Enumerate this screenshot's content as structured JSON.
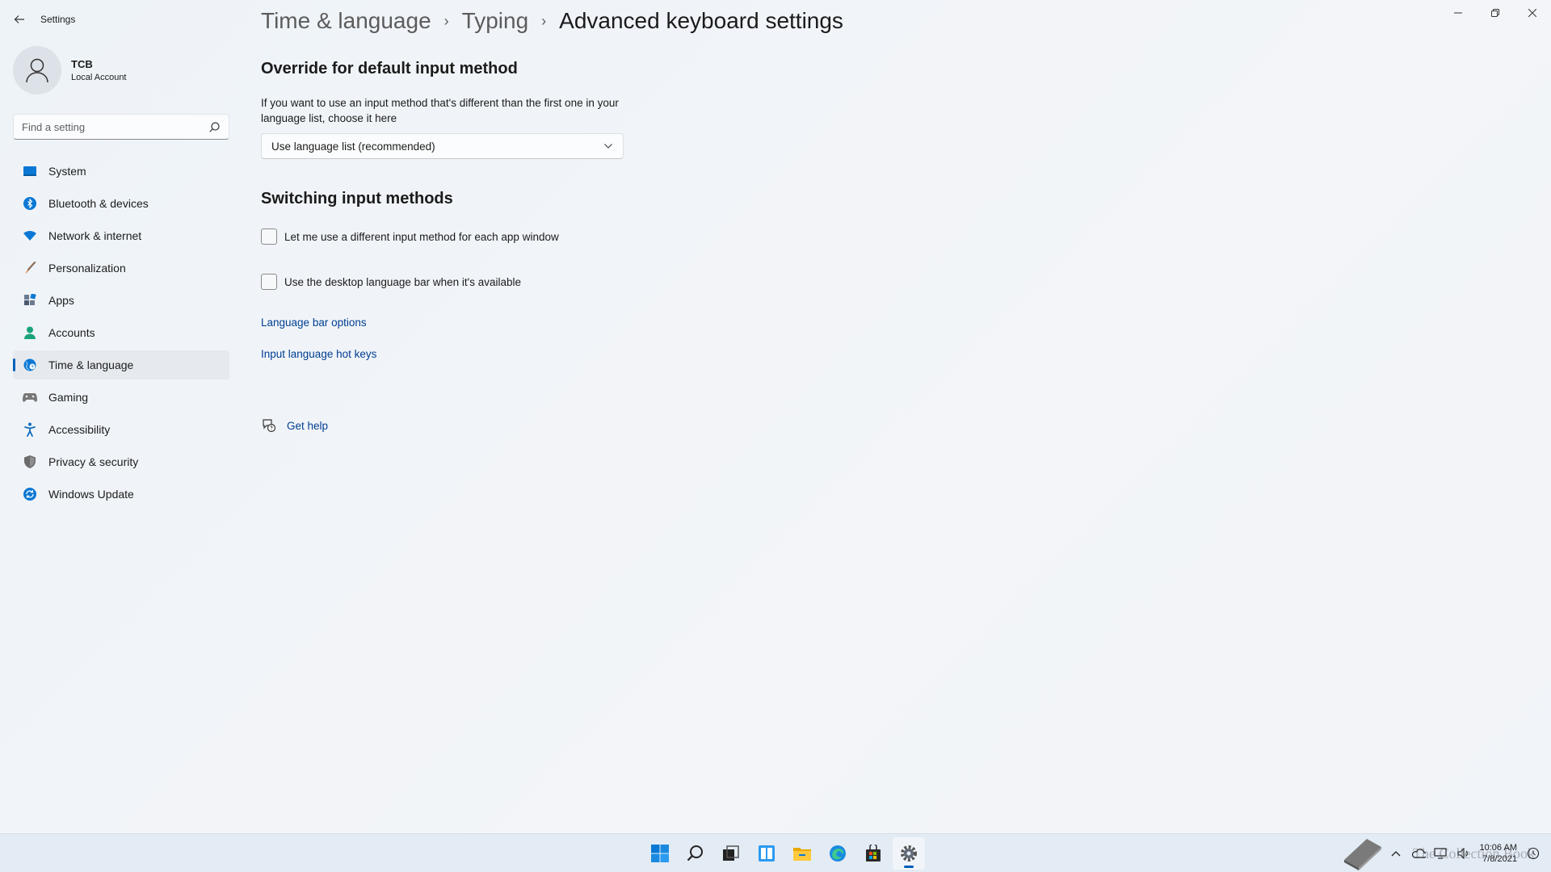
{
  "window": {
    "app_title": "Settings",
    "controls": {
      "minimize": "—",
      "restore": "❐",
      "close": "✕"
    }
  },
  "profile": {
    "name": "TCB",
    "account_type": "Local Account"
  },
  "search": {
    "placeholder": "Find a setting"
  },
  "sidebar": {
    "items": [
      {
        "label": "System",
        "icon": "system-icon",
        "color": "#0078d4"
      },
      {
        "label": "Bluetooth & devices",
        "icon": "bluetooth-icon",
        "color": "#0078d4"
      },
      {
        "label": "Network & internet",
        "icon": "wifi-icon",
        "color": "#0078d4"
      },
      {
        "label": "Personalization",
        "icon": "brush-icon",
        "color": "#e0722c"
      },
      {
        "label": "Apps",
        "icon": "apps-icon",
        "color": "#4a5a70"
      },
      {
        "label": "Accounts",
        "icon": "person-icon",
        "color": "#1aa37a"
      },
      {
        "label": "Time & language",
        "icon": "globe-clock-icon",
        "color": "#0078d4"
      },
      {
        "label": "Gaming",
        "icon": "gamepad-icon",
        "color": "#6b6b6b"
      },
      {
        "label": "Accessibility",
        "icon": "accessibility-icon",
        "color": "#0f6cbd"
      },
      {
        "label": "Privacy & security",
        "icon": "shield-icon",
        "color": "#6b6b6b"
      },
      {
        "label": "Windows Update",
        "icon": "update-icon",
        "color": "#0078d4"
      }
    ],
    "active_index": 6
  },
  "breadcrumb": {
    "items": [
      "Time & language",
      "Typing",
      "Advanced keyboard settings"
    ],
    "separator": "›"
  },
  "override_section": {
    "title": "Override for default input method",
    "description": "If you want to use an input method that's different than the first one in your language list, choose it here",
    "selected_value": "Use language list (recommended)"
  },
  "switching_section": {
    "title": "Switching input methods",
    "options": [
      {
        "label": "Let me use a different input method for each app window",
        "checked": false
      },
      {
        "label": "Use the desktop language bar when it's available",
        "checked": false
      }
    ]
  },
  "links": {
    "language_bar_options": "Language bar options",
    "input_language_hot_keys": "Input language hot keys"
  },
  "help": {
    "label": "Get help"
  },
  "taskbar": {
    "apps": [
      "start-icon",
      "search-icon",
      "task-view-icon",
      "widgets-icon",
      "file-explorer-icon",
      "edge-icon",
      "store-icon",
      "settings-icon"
    ],
    "clock_time": "10:06 AM",
    "clock_date": "7/8/2021",
    "watermark": "The Collection Book"
  },
  "colors": {
    "accent": "#005fb8",
    "link": "#003e92",
    "background": "#eff4f9"
  }
}
